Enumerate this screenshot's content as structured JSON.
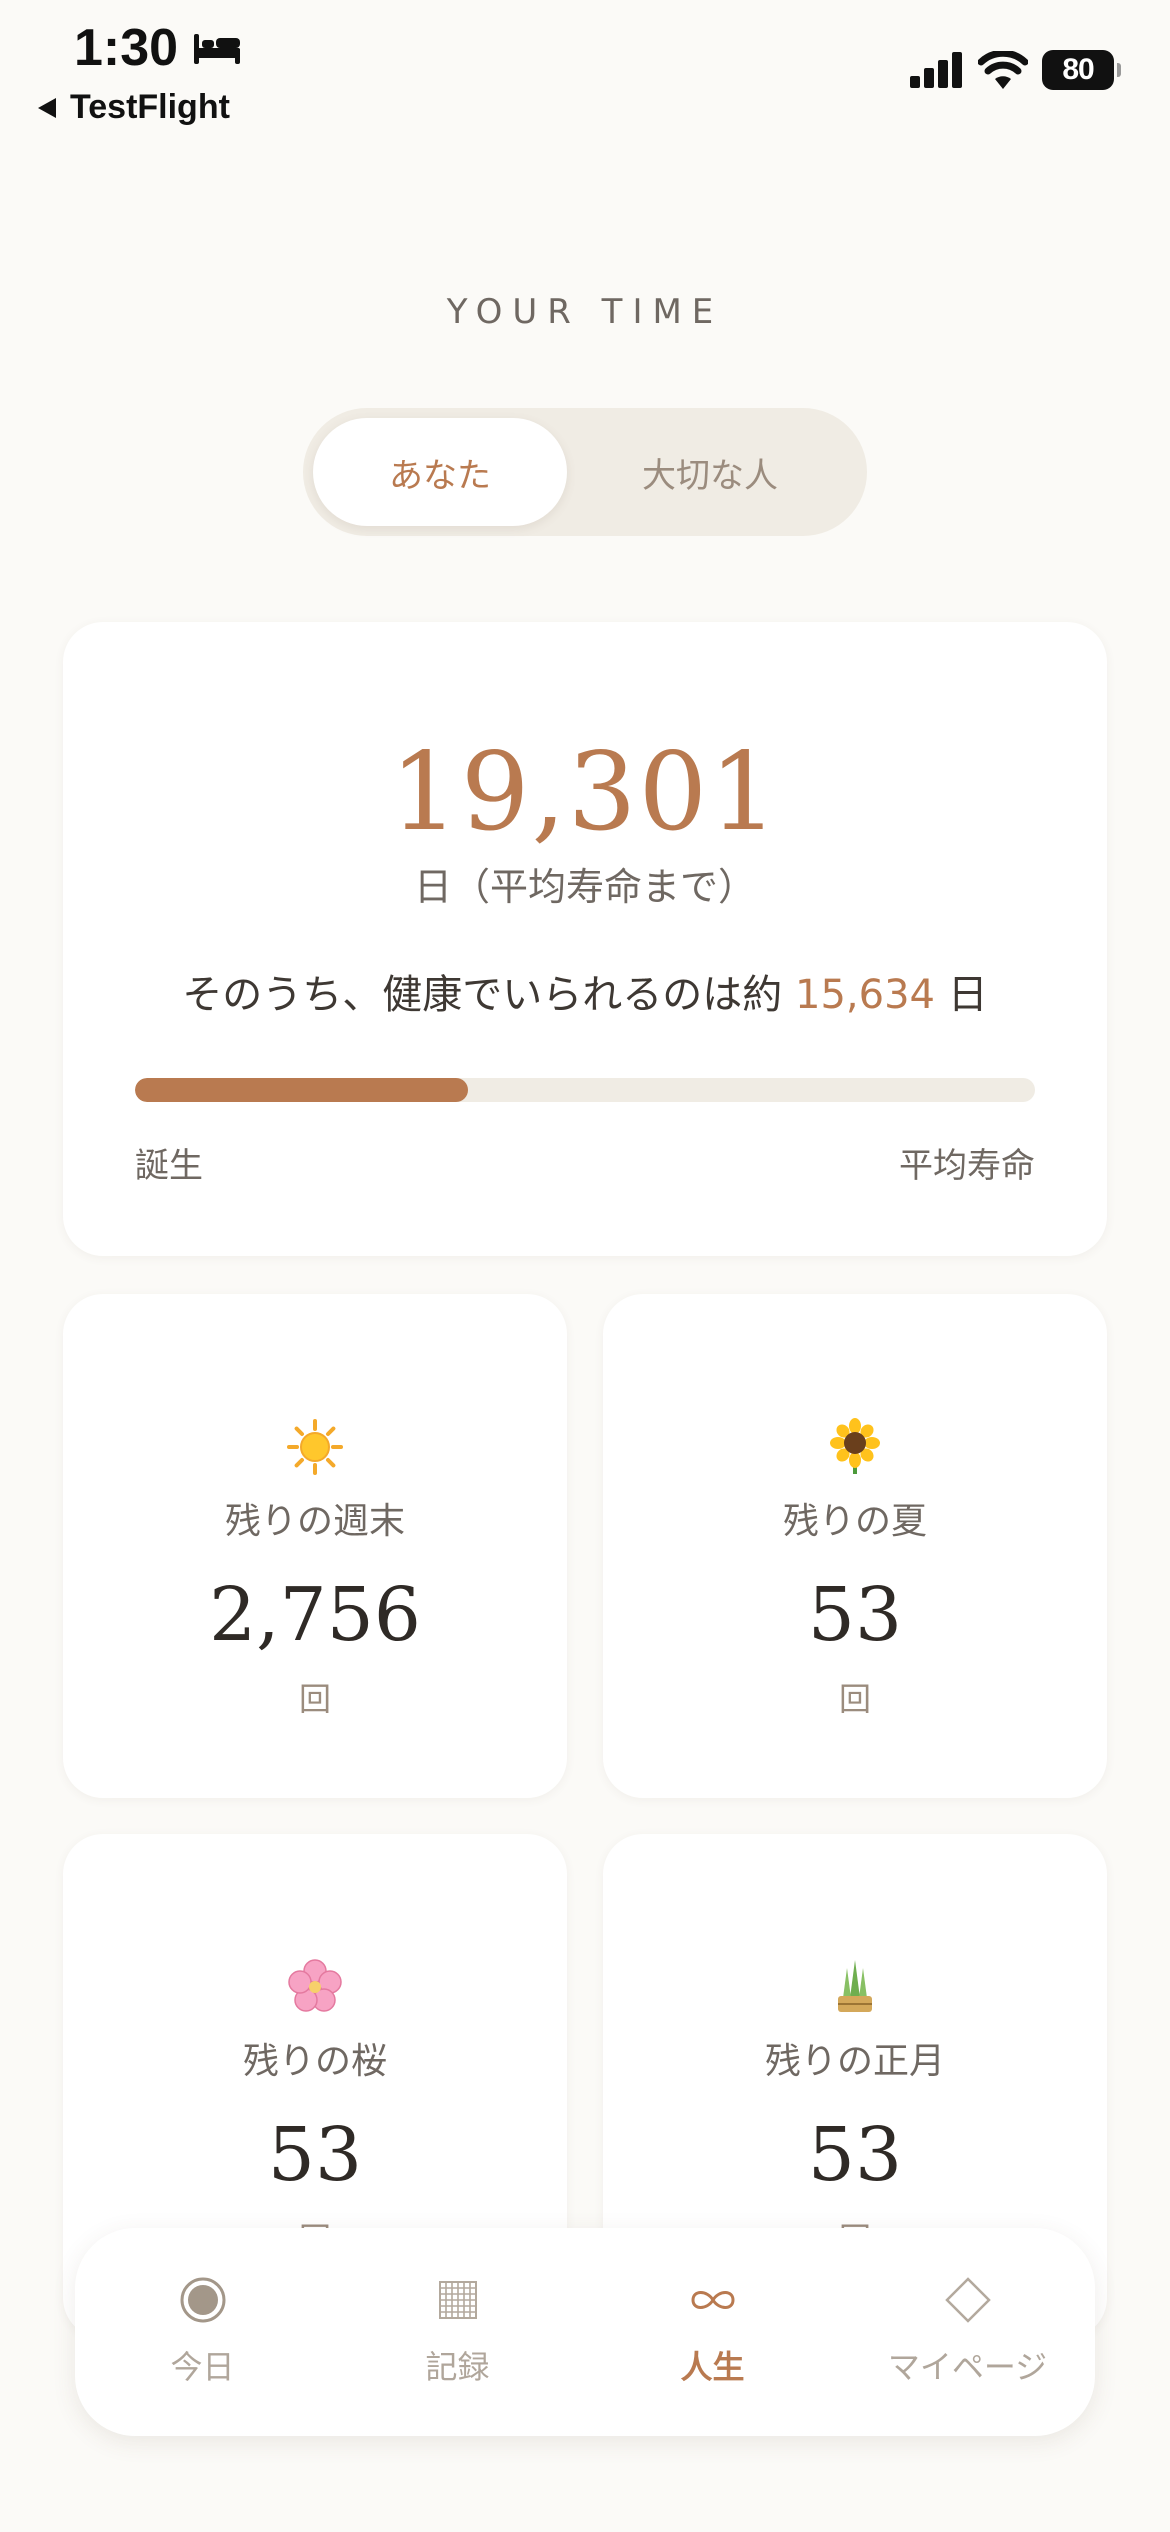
{
  "status_bar": {
    "time": "1:30",
    "back_label": "TestFlight",
    "battery": "80"
  },
  "header": {
    "title": "YOUR TIME",
    "segments": [
      "あなた",
      "大切な人"
    ],
    "active_segment": "あなた"
  },
  "main_card": {
    "days_remaining": "19,301",
    "unit_text": "日（平均寿命まで）",
    "healthy_prefix": "そのうち、健康でいられるのは約",
    "healthy_days": "15,634",
    "healthy_suffix": "日",
    "progress_fraction": 0.37,
    "label_start": "誕生",
    "label_end": "平均寿命",
    "accent_color": "#b97a50"
  },
  "stats": [
    {
      "icon": "sun-icon",
      "label": "残りの週末",
      "value": "2,756",
      "unit": "回"
    },
    {
      "icon": "sunflower-icon",
      "label": "残りの夏",
      "value": "53",
      "unit": "回"
    },
    {
      "icon": "cherry-blossom-icon",
      "label": "残りの桜",
      "value": "53",
      "unit": "回"
    },
    {
      "icon": "kadomatsu-icon",
      "label": "残りの正月",
      "value": "53",
      "unit": "回"
    }
  ],
  "tabbar": {
    "tabs": [
      {
        "label": "今日",
        "icon": "circle-dot-icon"
      },
      {
        "label": "記録",
        "icon": "grid-icon"
      },
      {
        "label": "人生",
        "icon": "infinity-icon"
      },
      {
        "label": "マイページ",
        "icon": "diamond-icon"
      }
    ],
    "active_tab": "人生"
  }
}
